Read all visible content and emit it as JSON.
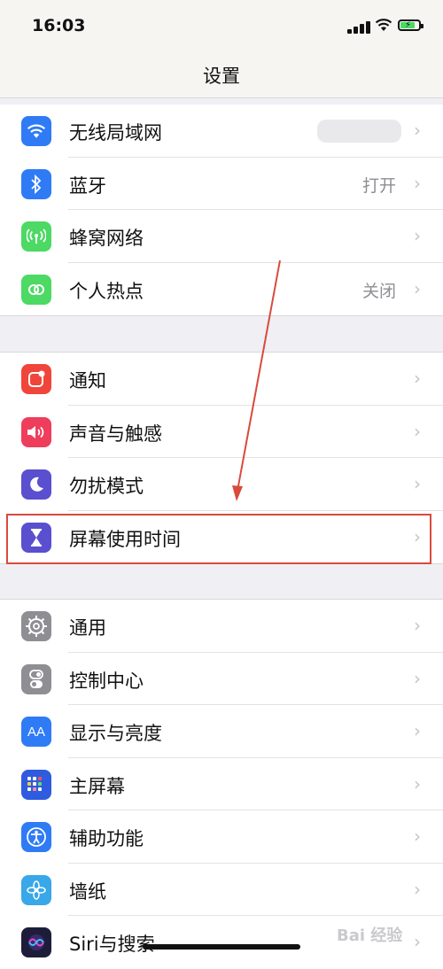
{
  "status_bar": {
    "time": "16:03"
  },
  "nav": {
    "title": "设置"
  },
  "groups": [
    {
      "items": [
        {
          "label": "无线局域网",
          "icon": "wifi-icon",
          "color": "#2f7bf6"
        },
        {
          "label": "蓝牙",
          "value": "打开",
          "icon": "bluetooth-icon",
          "color": "#2f7bf6"
        },
        {
          "label": "蜂窝网络",
          "icon": "cellular-icon",
          "color": "#4cd964"
        },
        {
          "label": "个人热点",
          "value": "关闭",
          "icon": "hotspot-icon",
          "color": "#4cd964"
        }
      ]
    },
    {
      "items": [
        {
          "label": "通知",
          "icon": "notification-icon",
          "color": "#f0453a"
        },
        {
          "label": "声音与触感",
          "icon": "sound-icon",
          "color": "#ee3e5b"
        },
        {
          "label": "勿扰模式",
          "icon": "moon-icon",
          "color": "#5a4fcf"
        },
        {
          "label": "屏幕使用时间",
          "icon": "hourglass-icon",
          "color": "#5a4fcf"
        }
      ]
    },
    {
      "items": [
        {
          "label": "通用",
          "icon": "gear-icon",
          "color": "#8e8e93"
        },
        {
          "label": "控制中心",
          "icon": "toggle-icon",
          "color": "#8e8e93"
        },
        {
          "label": "显示与亮度",
          "icon": "text-size-icon",
          "color": "#2f7bf6"
        },
        {
          "label": "主屏幕",
          "icon": "home-grid-icon",
          "color": "#2f5cde"
        },
        {
          "label": "辅助功能",
          "icon": "accessibility-icon",
          "color": "#2f7bf6"
        },
        {
          "label": "墙纸",
          "icon": "flower-icon",
          "color": "#38a8e8"
        },
        {
          "label": "Siri与搜索",
          "icon": "siri-icon",
          "color": "#1d1d3a"
        }
      ]
    }
  ],
  "icon_glyphs": {
    "text_size": "AA"
  },
  "watermark": "Bai 经验"
}
